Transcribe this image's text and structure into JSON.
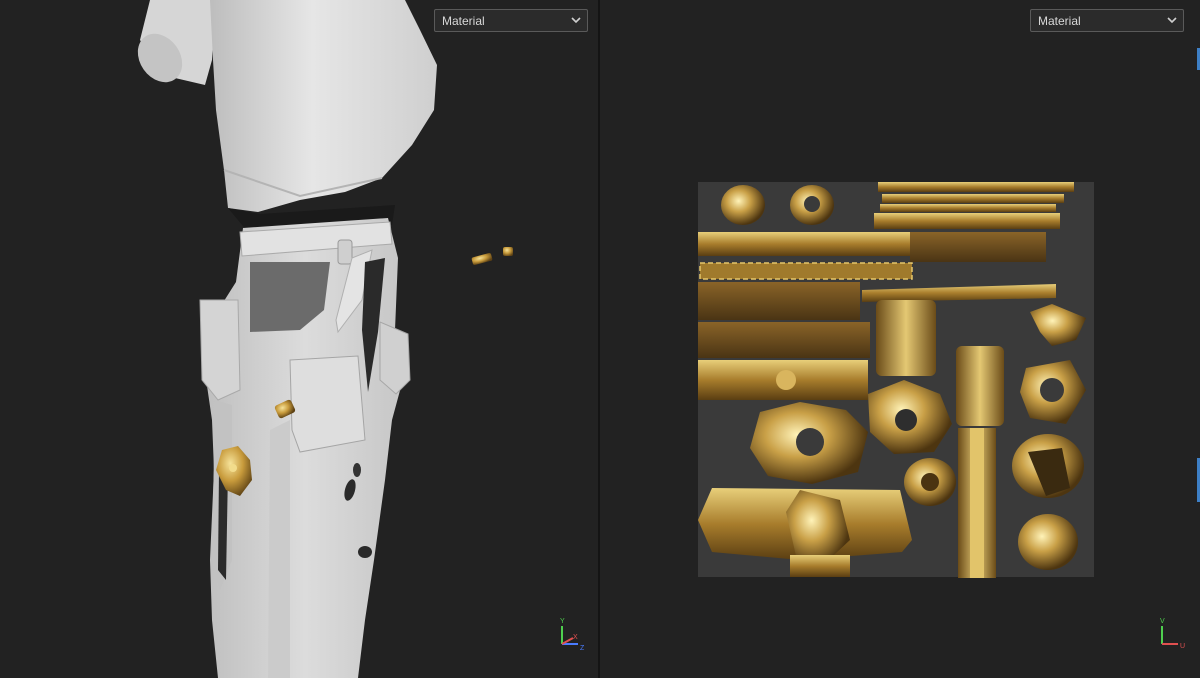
{
  "viewport_3d": {
    "shading_dropdown": {
      "value": "Material"
    },
    "axis_gizmo": {
      "y": "Y",
      "x": "X",
      "z": "Z"
    }
  },
  "viewport_uv": {
    "shading_dropdown": {
      "value": "Material"
    },
    "axis_gizmo": {
      "v": "V",
      "u": "U"
    }
  },
  "colors": {
    "background": "#222222",
    "cloth": "#d9d9d9",
    "gold": "#b8963c",
    "uv_canvas": "#3a3a3a",
    "accent": "#3d7fc6"
  }
}
